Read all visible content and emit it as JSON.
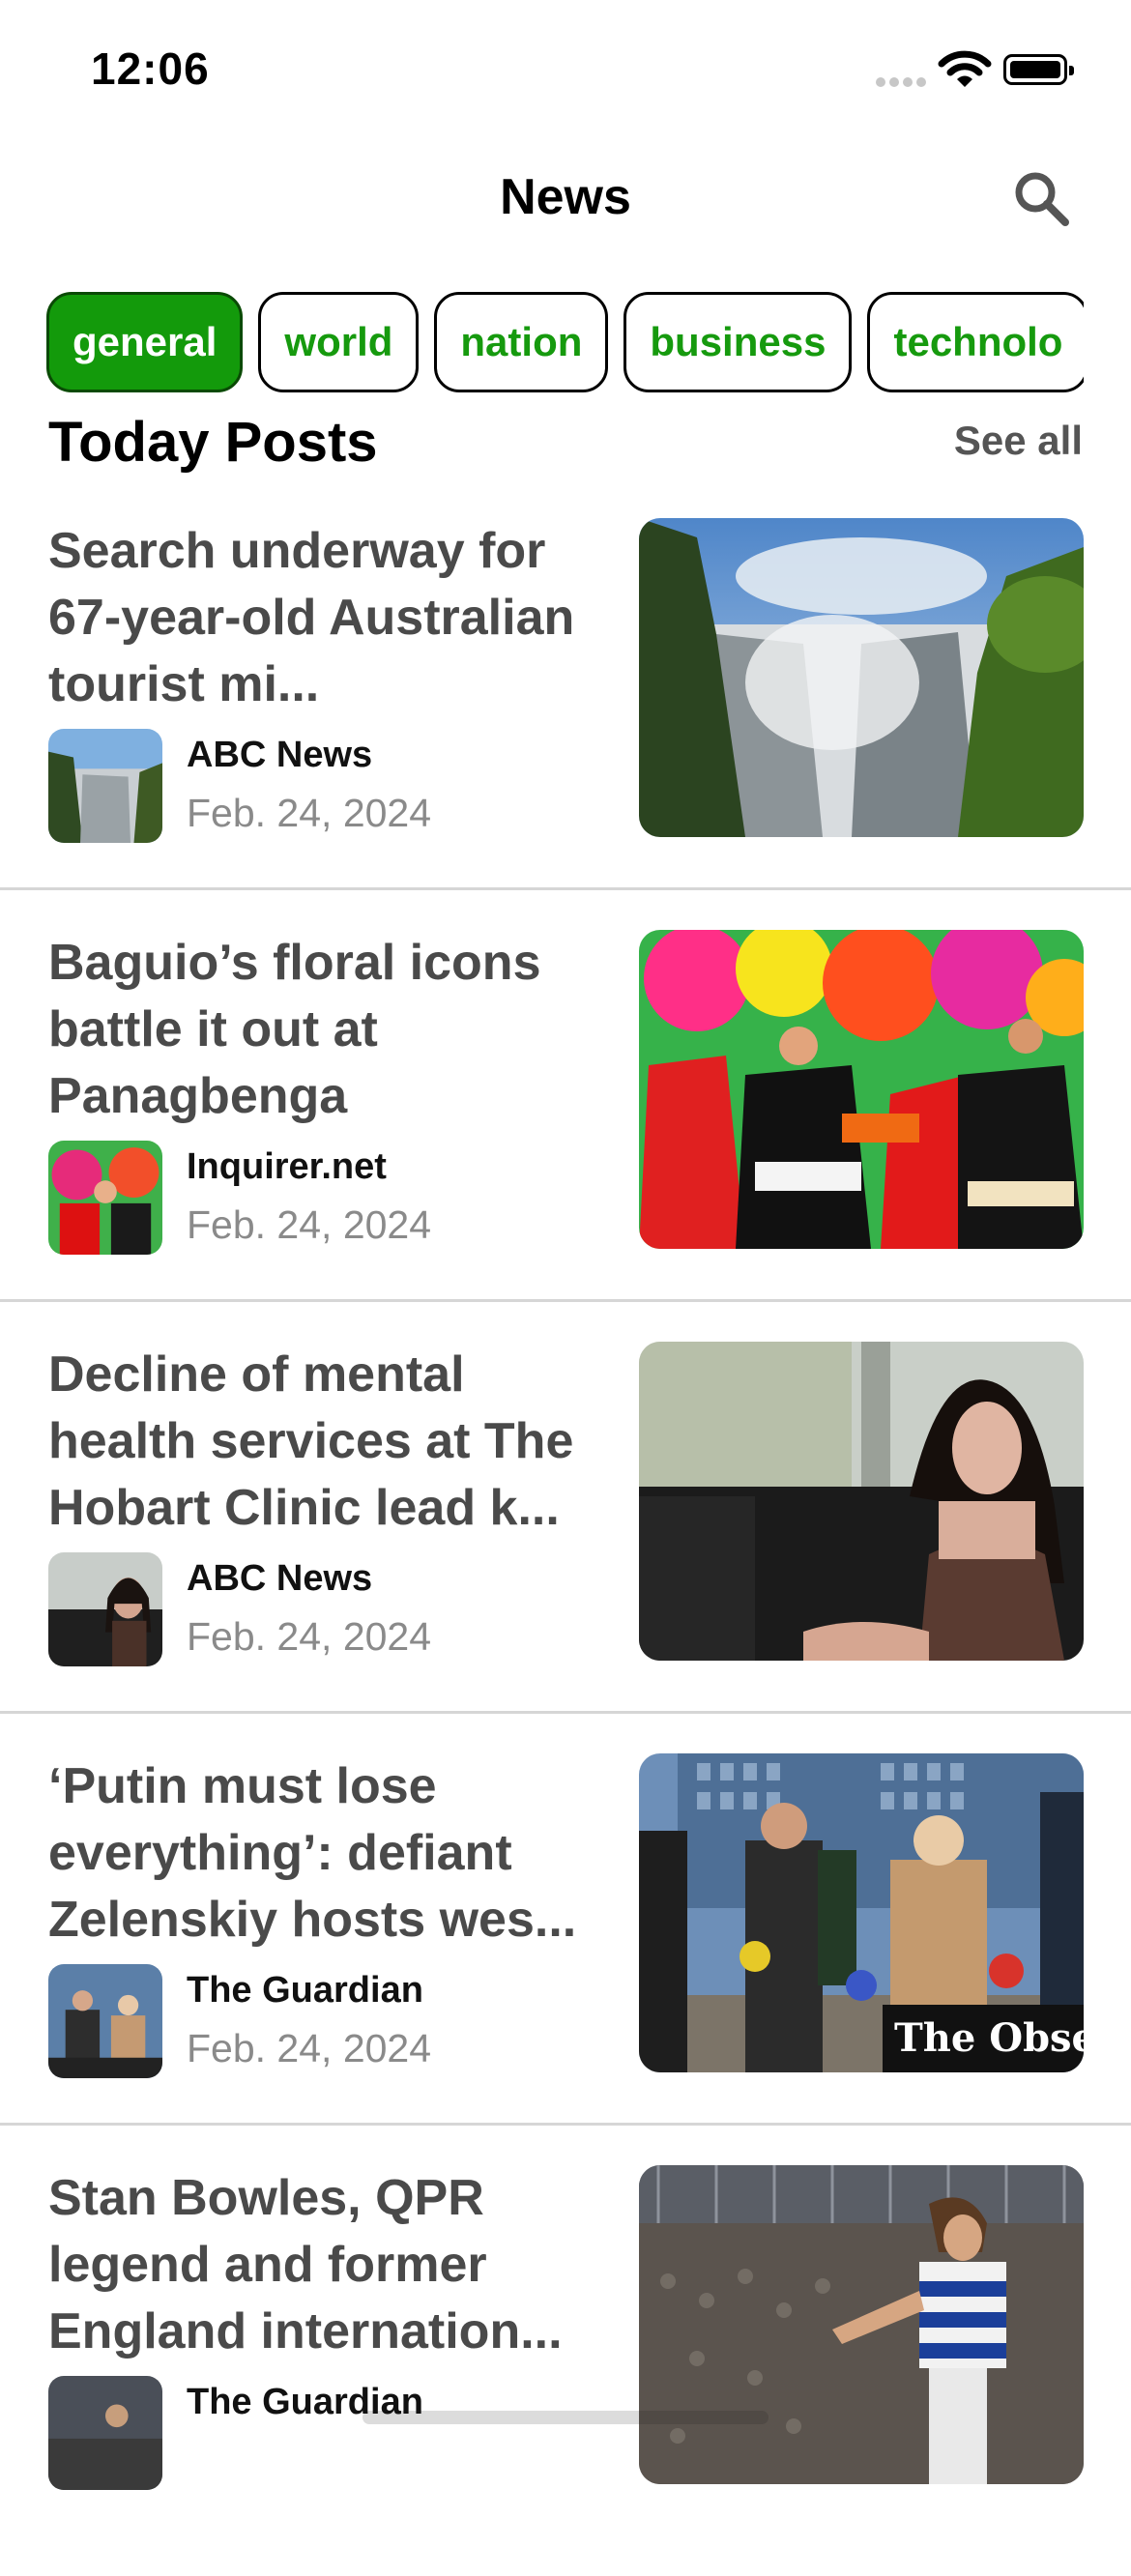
{
  "status": {
    "time": "12:06"
  },
  "nav": {
    "title": "News"
  },
  "categories": [
    "general",
    "world",
    "nation",
    "business",
    "technolo"
  ],
  "section": {
    "title": "Today Posts",
    "see_all": "See all"
  },
  "posts": [
    {
      "headline": "Search underway for 67-year-old Australian tourist mi...",
      "source": "ABC News",
      "date": "Feb. 24, 2024"
    },
    {
      "headline": "Baguio’s floral icons battle it out at Panagbenga",
      "source": "Inquirer.net",
      "date": "Feb. 24, 2024"
    },
    {
      "headline": "Decline of mental health services at The Hobart Clinic lead k...",
      "source": "ABC News",
      "date": "Feb. 24, 2024"
    },
    {
      "headline": "‘Putin must lose everything’: defiant Zelenskiy hosts wes...",
      "source": "The Guardian",
      "date": "Feb. 24, 2024",
      "photo_watermark": "The Obser"
    },
    {
      "headline": "Stan Bowles, QPR legend and former England internation...",
      "source": "The Guardian",
      "date": ""
    }
  ],
  "colors": {
    "accent": "#139a0b",
    "accent_text": "#169a0e",
    "headline": "#4a4a4a",
    "date": "#8a8a8a"
  }
}
